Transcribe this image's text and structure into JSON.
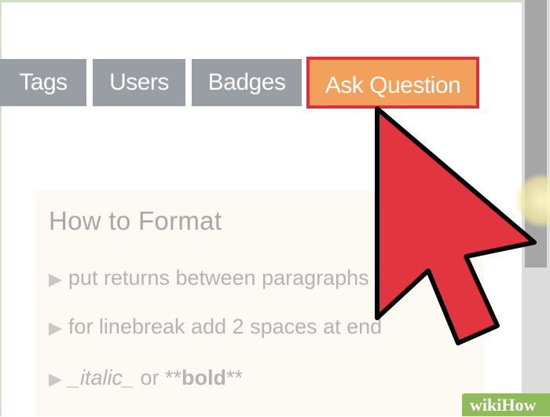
{
  "nav": {
    "tags_label": "Tags",
    "users_label": "Users",
    "badges_label": "Badges",
    "ask_label": "Ask Question"
  },
  "format_help": {
    "title": "How to Format",
    "tip_1": "put returns between paragraphs",
    "tip_2": "for linebreak add 2 spaces at end",
    "tip_3_italic": "_italic_",
    "tip_3_or": " or ",
    "tip_3_bold_open": "**",
    "tip_3_bold": "bold",
    "tip_3_bold_close": "**",
    "bullet_icon": "triangle-right-icon"
  },
  "watermark": {
    "wiki": "wiki",
    "how": "How"
  },
  "colors": {
    "nav_button": "#999ea5",
    "ask_button": "#f2a05c",
    "ask_border": "#d9313f",
    "cursor_red": "#e2353f",
    "badge_green": "#8fbb5a"
  }
}
